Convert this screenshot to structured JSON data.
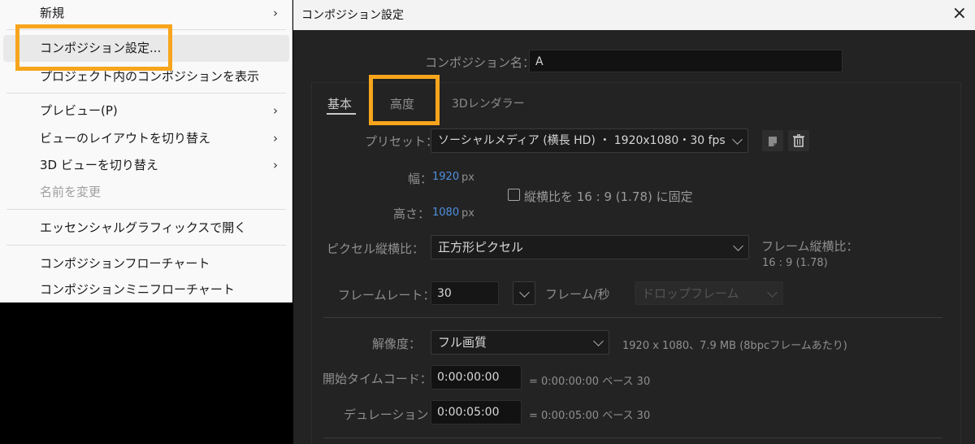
{
  "context_menu": {
    "items": [
      {
        "label": "新規",
        "arrow": "›"
      },
      {
        "label": "コンポジション設定..."
      },
      {
        "label": "プロジェクト内のコンポジションを表示"
      },
      {
        "label": "プレビュー(P)",
        "arrow": "›"
      },
      {
        "label": "ビューのレイアウトを切り替え",
        "arrow": "›"
      },
      {
        "label": "3D ビューを切り替え",
        "arrow": "›"
      },
      {
        "label": "名前を変更"
      },
      {
        "label": "エッセンシャルグラフィックスで開く"
      },
      {
        "label": "コンポジションフローチャート"
      },
      {
        "label": "コンポジションミニフローチャート"
      }
    ]
  },
  "dialog": {
    "title": "コンポジション設定",
    "close_icon": "×",
    "name_label": "コンポジション名：",
    "name_value": "A",
    "tabs": [
      "基本",
      "高度",
      "3Dレンダラー"
    ],
    "preset_label": "プリセット：",
    "preset_value": "ソーシャルメディア (横長 HD) ・ 1920x1080・30 fps",
    "width_label": "幅：",
    "width_value": "1920",
    "width_unit": "px",
    "height_label": "高さ：",
    "height_value": "1080",
    "height_unit": "px",
    "lock_label": "縦横比を 16 : 9 (1.78) に固定",
    "par_label": "ピクセル縦横比：",
    "par_value": "正方形ピクセル",
    "frame_aspect_label": "フレーム縦横比：",
    "frame_aspect_value": "16 : 9 (1.78)",
    "framerate_label": "フレームレート：",
    "framerate_value": "30",
    "framerate_unit": "フレーム/秒",
    "dropframe_value": "ドロップフレーム",
    "resolution_label": "解像度：",
    "resolution_value": "フル画質",
    "resolution_info": "1920 x 1080、7.9 MB (8bpcフレームあたり)",
    "start_tc_label": "開始タイムコード：",
    "start_tc_value": "0:00:00:00",
    "start_tc_info": "= 0:00:00:00  ベース 30",
    "duration_label": "デュレーション：",
    "duration_value": "0:00:05:00",
    "duration_info": "= 0:00:05:00  ベース 30"
  },
  "colors": {
    "highlight": "#f7a51c",
    "dialog_bg": "#232323",
    "value_blue": "#4e90e0"
  }
}
